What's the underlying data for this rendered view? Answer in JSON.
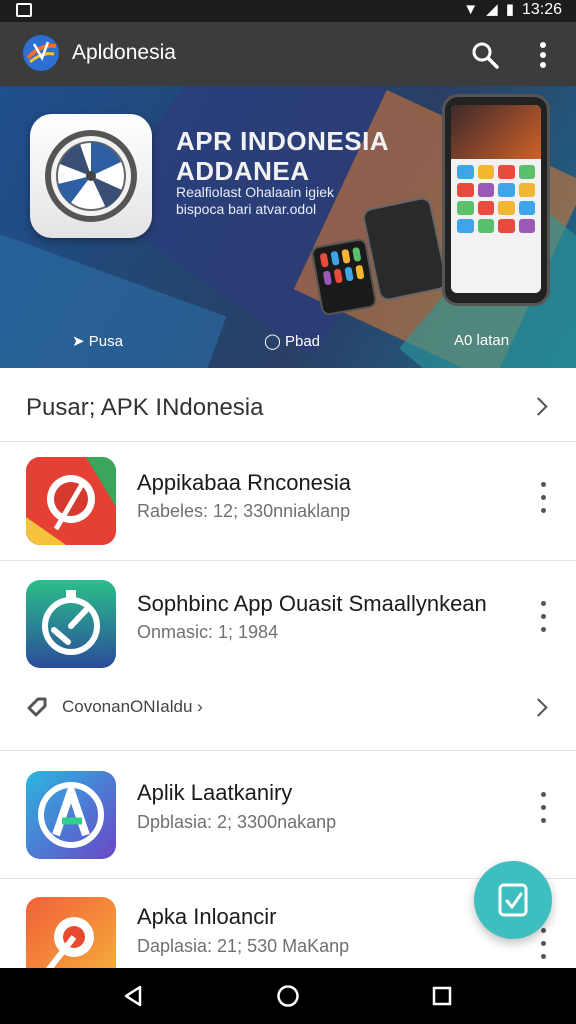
{
  "status_bar": {
    "time": "13:26"
  },
  "app_bar": {
    "title": "Apldonesia"
  },
  "banner": {
    "title_line1": "APR INDONESIA",
    "title_line2": "ADDANEA",
    "subtitle_line1": "Realfiolast Ohalaain igiek",
    "subtitle_line2": "bispoca bari atvar.odol",
    "tabs": [
      "Pusa",
      "Pbad",
      "A0 latan"
    ]
  },
  "section": {
    "title": "Pusar; APK INdonesia"
  },
  "items": [
    {
      "title": "Appikabaa Rnconesia",
      "subtitle": "Rabeles: 12; 330nniaklanp"
    },
    {
      "title": "Sophbinc App Ouasit Smaallynkean",
      "subtitle": "Onmasic: 1; 1984"
    },
    {
      "title": "Aplik Laatkaniry",
      "subtitle": "Dpblasia: 2; 3300nakanp"
    },
    {
      "title": "Apka Inloancir",
      "subtitle": "Daplasia: 21; 530 MaKanp"
    }
  ],
  "link_row": {
    "label": "CovonanONIaldu"
  },
  "colors": {
    "app_bar": "#3c3c3c",
    "fab": "#3dbfbf",
    "accent_blue": "#24456f"
  },
  "icons": [
    "wifi-icon",
    "signal-icon",
    "battery-icon",
    "search-icon",
    "more-vert-icon",
    "chevron-right-icon",
    "tag-icon",
    "download-icon",
    "back-icon",
    "home-icon",
    "recents-icon"
  ]
}
